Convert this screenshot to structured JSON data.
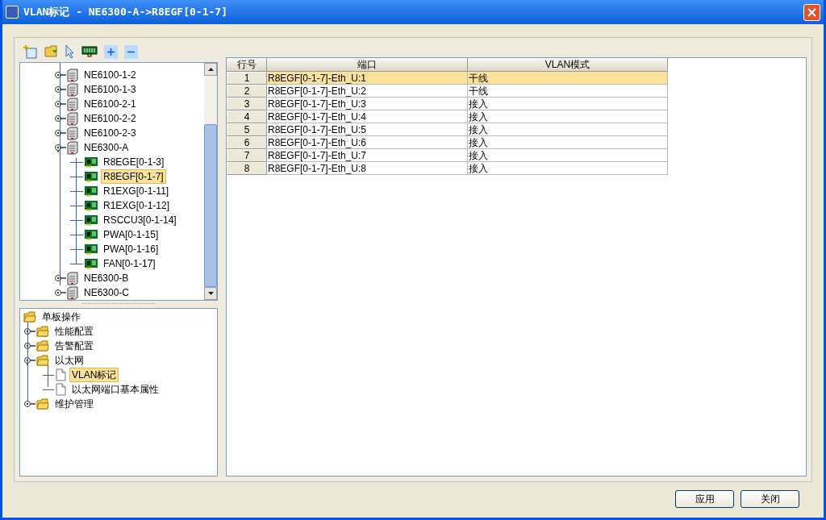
{
  "window": {
    "title": "VLAN标记 - NE6300-A->R8EGF[0-1-7]"
  },
  "device_tree": [
    {
      "label": "NE6100-1-2",
      "kind": "server",
      "expanded": false,
      "selected": false
    },
    {
      "label": "NE6100-1-3",
      "kind": "server",
      "expanded": false,
      "selected": false
    },
    {
      "label": "NE6100-2-1",
      "kind": "server",
      "expanded": false,
      "selected": false
    },
    {
      "label": "NE6100-2-2",
      "kind": "server",
      "expanded": false,
      "selected": false
    },
    {
      "label": "NE6100-2-3",
      "kind": "server",
      "expanded": false,
      "selected": false
    },
    {
      "label": "NE6300-A",
      "kind": "server",
      "expanded": true,
      "selected": false,
      "children": [
        {
          "label": "R8EGE[0-1-3]",
          "kind": "card",
          "selected": false
        },
        {
          "label": "R8EGF[0-1-7]",
          "kind": "card",
          "selected": true
        },
        {
          "label": "R1EXG[0-1-11]",
          "kind": "card",
          "selected": false
        },
        {
          "label": "R1EXG[0-1-12]",
          "kind": "card",
          "selected": false
        },
        {
          "label": "RSCCU3[0-1-14]",
          "kind": "card",
          "selected": false
        },
        {
          "label": "PWA[0-1-15]",
          "kind": "card",
          "selected": false
        },
        {
          "label": "PWA[0-1-16]",
          "kind": "card",
          "selected": false
        },
        {
          "label": "FAN[0-1-17]",
          "kind": "card",
          "selected": false
        }
      ]
    },
    {
      "label": "NE6300-B",
      "kind": "server",
      "expanded": false,
      "selected": false
    },
    {
      "label": "NE6300-C",
      "kind": "server",
      "expanded": false,
      "selected": false
    }
  ],
  "operation_tree": {
    "label": "单板操作",
    "kind": "folder",
    "selected": false,
    "children": [
      {
        "label": "性能配置",
        "kind": "folder",
        "expanded": false,
        "selected": false
      },
      {
        "label": "告警配置",
        "kind": "folder",
        "expanded": false,
        "selected": false
      },
      {
        "label": "以太网",
        "kind": "folder",
        "expanded": true,
        "selected": false,
        "children": [
          {
            "label": "VLAN标记",
            "kind": "doc",
            "selected": true
          },
          {
            "label": "以太网端口基本属性",
            "kind": "doc",
            "selected": false
          }
        ]
      },
      {
        "label": "维护管理",
        "kind": "folder",
        "expanded": false,
        "selected": false
      }
    ]
  },
  "table": {
    "columns": [
      "行号",
      "端口",
      "VLAN模式"
    ],
    "rows": [
      {
        "cells": [
          "1",
          "R8EGF[0-1-7]-Eth_U:1",
          "干线"
        ],
        "selected": true
      },
      {
        "cells": [
          "2",
          "R8EGF[0-1-7]-Eth_U:2",
          "干线"
        ],
        "selected": false
      },
      {
        "cells": [
          "3",
          "R8EGF[0-1-7]-Eth_U:3",
          "接入"
        ],
        "selected": false
      },
      {
        "cells": [
          "4",
          "R8EGF[0-1-7]-Eth_U:4",
          "接入"
        ],
        "selected": false
      },
      {
        "cells": [
          "5",
          "R8EGF[0-1-7]-Eth_U:5",
          "接入"
        ],
        "selected": false
      },
      {
        "cells": [
          "6",
          "R8EGF[0-1-7]-Eth_U:6",
          "接入"
        ],
        "selected": false
      },
      {
        "cells": [
          "7",
          "R8EGF[0-1-7]-Eth_U:7",
          "接入"
        ],
        "selected": false
      },
      {
        "cells": [
          "8",
          "R8EGF[0-1-7]-Eth_U:8",
          "接入"
        ],
        "selected": false
      }
    ]
  },
  "buttons": [
    "应用",
    "关闭"
  ]
}
